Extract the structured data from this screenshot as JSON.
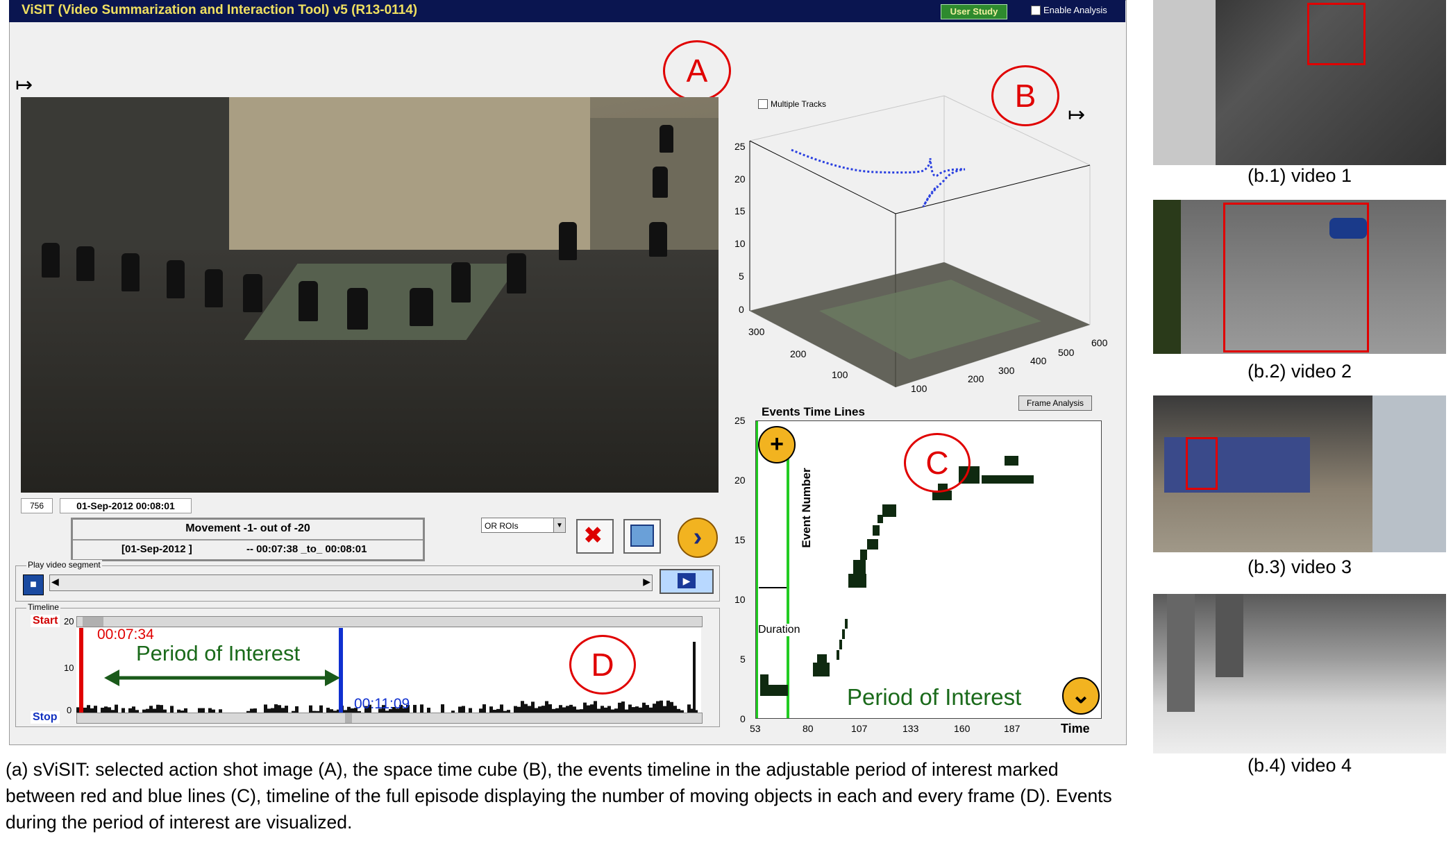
{
  "app": {
    "title": "ViSIT (Video Summarization and Interaction Tool)  v5 (R13-0114)",
    "user_study_label": "User Study",
    "enable_analysis_label": "Enable Analysis"
  },
  "markers": {
    "a": "A",
    "b": "B",
    "c": "C",
    "d": "D"
  },
  "video": {
    "frame_number": "756",
    "date_time": "01-Sep-2012 00:08:01"
  },
  "movement": {
    "line1": "Movement -1- out of -20",
    "date": "[01-Sep-2012 ]",
    "range": "-- 00:07:38 _to_ 00:08:01"
  },
  "roi_select": {
    "selected": "OR ROIs"
  },
  "play_segment": {
    "label": "Play video segment"
  },
  "timeline": {
    "label": "Timeline",
    "start_label": "Start",
    "stop_label": "Stop",
    "start_time": "00:07:34",
    "stop_time": "00:11:09",
    "poi_text": "Period of Interest",
    "y_ticks": [
      "20",
      "10",
      "0"
    ]
  },
  "cube": {
    "multiple_tracks_label": "Multiple Tracks",
    "z_ticks": [
      "25",
      "20",
      "15",
      "10",
      "5",
      "0"
    ],
    "y_ticks": [
      "300",
      "200",
      "100"
    ],
    "x_ticks": [
      "100",
      "200",
      "300",
      "400",
      "500",
      "600"
    ]
  },
  "frame_analysis_label": "Frame Analysis",
  "events": {
    "title": "Events Time Lines",
    "ylabel": "Event Number",
    "xlabel": "Time",
    "duration_label": "Duration",
    "poi_text": "Period of Interest",
    "y_ticks": [
      "25",
      "20",
      "15",
      "10",
      "5",
      "0"
    ],
    "x_ticks": [
      "53",
      "80",
      "107",
      "133",
      "160",
      "187"
    ]
  },
  "side_videos": [
    {
      "caption": "(b.1) video 1"
    },
    {
      "caption": "(b.2) video 2"
    },
    {
      "caption": "(b.3) video 3"
    },
    {
      "caption": "(b.4) video 4"
    }
  ],
  "caption": "(a) sViSIT: selected action shot image (A), the space time cube (B), the events timeline in the adjustable period of interest marked between red and blue lines (C), timeline of the full episode displaying the number of moving objects in each and every frame (D). Events during the period of interest are visualized.",
  "colors": {
    "title_bar": "#0a1550",
    "marker_red": "#e00000",
    "poi_green": "#1a6a1a",
    "button_yellow": "#f2b320"
  }
}
